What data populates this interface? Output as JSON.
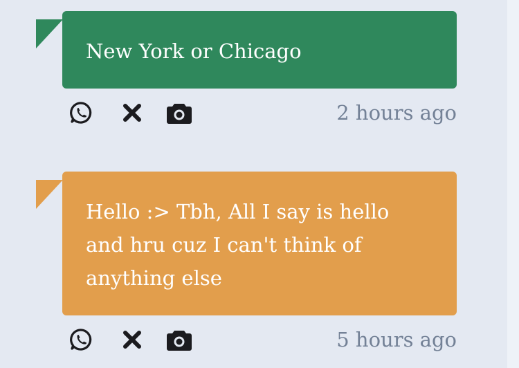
{
  "colors": {
    "background": "#e4e9f2",
    "card_green": "#2f885c",
    "card_orange": "#e29e4c",
    "timestamp": "#738196",
    "icon": "#1b1b1f"
  },
  "messages": [
    {
      "text": "New York or Chicago",
      "timestamp": "2 hours ago",
      "icons": [
        "whatsapp-icon",
        "close-icon",
        "camera-icon"
      ]
    },
    {
      "text": "Hello :> Tbh, All I say is hello and hru cuz I can't think of anything else",
      "timestamp": "5 hours ago",
      "icons": [
        "whatsapp-icon",
        "close-icon",
        "camera-icon"
      ]
    }
  ]
}
